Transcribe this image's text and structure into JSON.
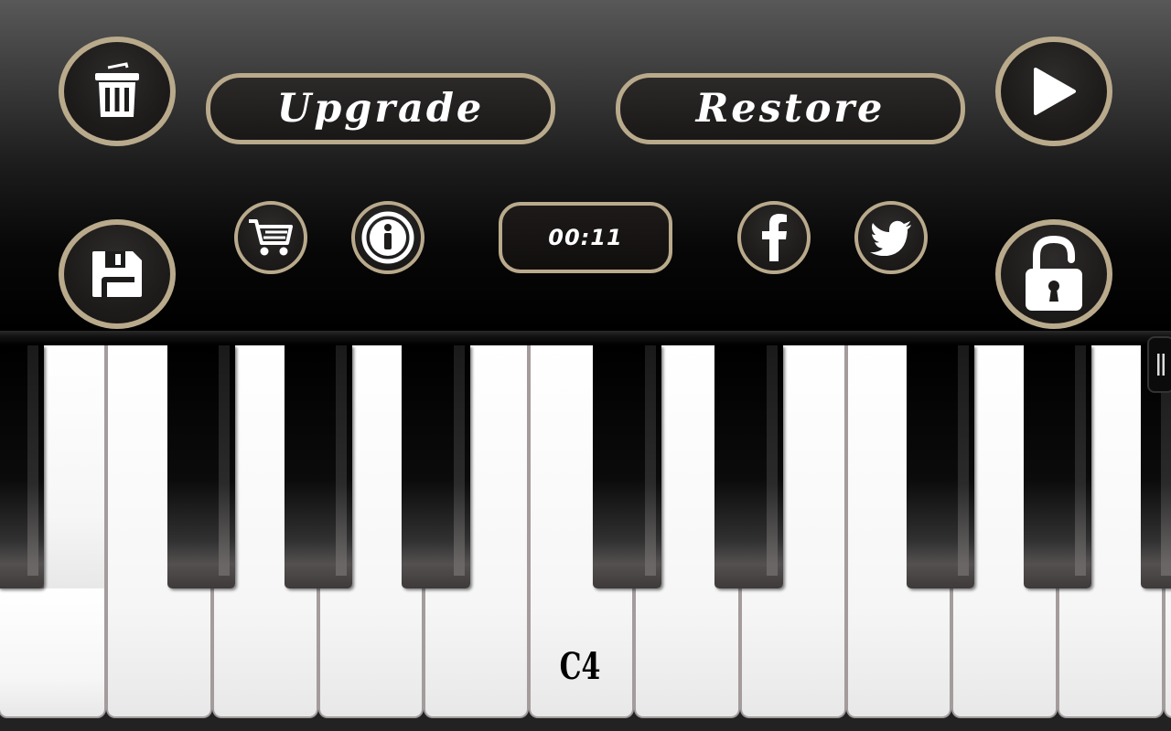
{
  "toolbar": {
    "upgrade_label": "Upgrade",
    "restore_label": "Restore",
    "timer": "00:11"
  },
  "icons": {
    "trash": "trash-icon",
    "play": "play-icon",
    "save": "floppy-disk-icon",
    "cart": "shopping-cart-icon",
    "info": "info-icon",
    "facebook": "facebook-icon",
    "twitter": "twitter-icon",
    "unlock": "unlocked-padlock-icon",
    "handle": "drag-handle-icon"
  },
  "keyboard": {
    "visible_note_label": "C4"
  },
  "colors": {
    "button_border": "#b9aa8c",
    "button_fill": "#1e1b1b"
  }
}
